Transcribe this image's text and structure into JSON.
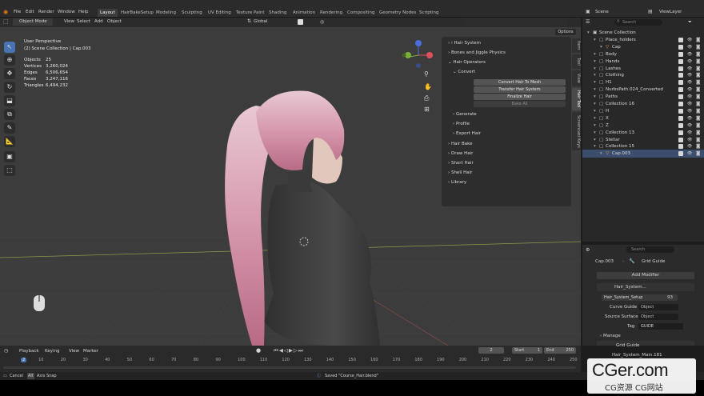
{
  "topbar": {
    "menus": [
      "File",
      "Edit",
      "Render",
      "Window",
      "Help"
    ],
    "workspaces": [
      "Layout",
      "HairBakeSetup",
      "Modeling",
      "Sculpting",
      "UV Editing",
      "Texture Paint",
      "Shading",
      "Animation",
      "Rendering",
      "Compositing",
      "Geometry Nodes",
      "Scripting"
    ],
    "scene": "Scene",
    "view_layer": "ViewLayer"
  },
  "viewport": {
    "mode": "Object Mode",
    "menus": [
      "View",
      "Select",
      "Add",
      "Object"
    ],
    "orientation": "Global",
    "options": "Options",
    "perspective": "User Perspective",
    "collection_line": "(2) Scene Collection | Cap.003",
    "stats": [
      {
        "label": "Objects",
        "value": "25"
      },
      {
        "label": "Vertices",
        "value": "3,260,024"
      },
      {
        "label": "Edges",
        "value": "6,506,654"
      },
      {
        "label": "Faces",
        "value": "3,247,116"
      },
      {
        "label": "Triangles",
        "value": "6,494,232"
      }
    ]
  },
  "npanel": {
    "items": [
      {
        "label": "Hair System",
        "arrow": "›"
      },
      {
        "label": "Bones and Jiggle Physics",
        "arrow": "›"
      },
      {
        "label": "Hair Operators",
        "arrow": "⌄"
      },
      {
        "label": "Convert",
        "arrow": "⌄"
      }
    ],
    "buttons": [
      "Convert Hair To Mesh",
      "Transfer Hair System",
      "Finalize Hair",
      "Bake All"
    ],
    "sub_items": [
      "Generate",
      "Profile",
      "Export Hair"
    ],
    "sections": [
      "Hair Bake",
      "Draw Hair",
      "Short Hair",
      "Shell Hair",
      "Library"
    ],
    "tabs": [
      "Item",
      "Tool",
      "View",
      "Hair Tool",
      "Screencast Keys"
    ]
  },
  "outliner": {
    "search_placeholder": "Search",
    "items": [
      {
        "label": "Scene Collection",
        "indent": 0
      },
      {
        "label": "Place_holders",
        "indent": 1
      },
      {
        "label": "Cap",
        "indent": 2
      },
      {
        "label": "Body",
        "indent": 1
      },
      {
        "label": "Hands",
        "indent": 1
      },
      {
        "label": "Lashes",
        "indent": 1
      },
      {
        "label": "Clothing",
        "indent": 1
      },
      {
        "label": "H1",
        "indent": 1
      },
      {
        "label": "NurbsPath.024_Converted",
        "indent": 1
      },
      {
        "label": "Paths",
        "indent": 1
      },
      {
        "label": "Collection 16",
        "indent": 1
      },
      {
        "label": "H",
        "indent": 1
      },
      {
        "label": "X",
        "indent": 1
      },
      {
        "label": "Z",
        "indent": 1
      },
      {
        "label": "Collection 13",
        "indent": 1
      },
      {
        "label": "Stellar",
        "indent": 1
      },
      {
        "label": "Collection 15",
        "indent": 1
      },
      {
        "label": "Cap.003",
        "indent": 2
      }
    ]
  },
  "properties": {
    "object": "Cap.003",
    "modifier_name": "Grid Guide",
    "add_modifier": "Add Modifier",
    "mod1": "Hair_System...",
    "mod1_node": "Hair_System_Setup",
    "mod1_count": "93",
    "curve_guide_label": "Curve Guide",
    "source_surface_label": "Source Surface",
    "object_placeholder": "Object",
    "tag_label": "Tag",
    "tag_value": "GUIDE",
    "manage": "Manage",
    "mod2": "Grid Guide",
    "mod2_node": "Hair_System_Main.181"
  },
  "timeline": {
    "menus": [
      "Playback",
      "Keying",
      "View",
      "Marker"
    ],
    "current_frame": "2",
    "start_label": "Start",
    "start": "1",
    "end_label": "End",
    "end": "250",
    "ticks": [
      "2",
      "10",
      "20",
      "30",
      "40",
      "50",
      "60",
      "70",
      "80",
      "90",
      "100",
      "110",
      "120",
      "130",
      "140",
      "150",
      "160",
      "170",
      "180",
      "190",
      "200",
      "210",
      "220",
      "230",
      "240",
      "250"
    ]
  },
  "status": {
    "cancel": "Cancel",
    "alt": "Alt",
    "axis_snap": "Axis Snap",
    "saved": "Saved \"Course_Hair.blend\""
  },
  "watermark": {
    "main": "CGer.com",
    "sub": "CG资源 CG网站"
  }
}
